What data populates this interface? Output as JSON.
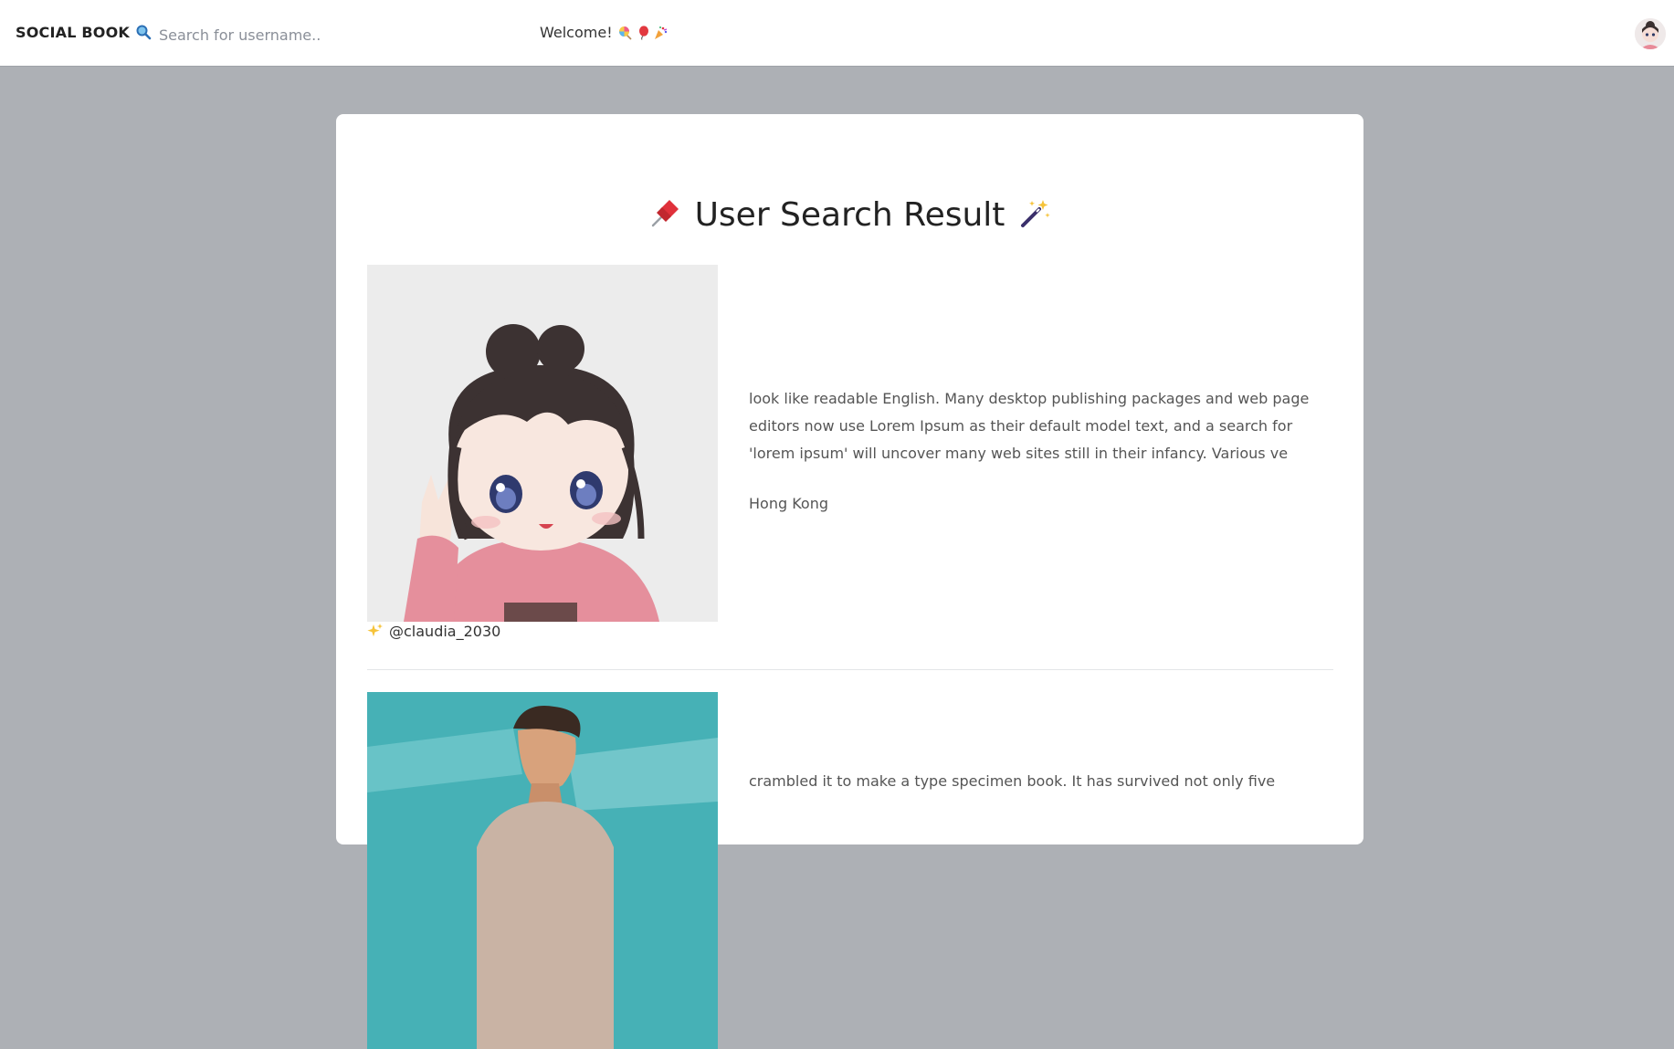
{
  "header": {
    "brand": "SOCIAL BOOK",
    "search": {
      "placeholder": "Search for username..",
      "value": ""
    },
    "welcome": "Welcome!",
    "welcome_icons": [
      "lollipop-icon",
      "balloon-icon",
      "party-popper-icon"
    ],
    "avatar_icon": "user-avatar-icon"
  },
  "page": {
    "title": "User Search Result",
    "title_icons": [
      "pushpin-icon",
      "magic-wand-icon"
    ]
  },
  "results": [
    {
      "handle": "@claudia_2030",
      "bio": "look like readable English. Many desktop publishing packages and web page editors now use Lorem Ipsum as their default model text, and a search for 'lorem ipsum' will uncover many web sites still in their infancy. Various ve",
      "location": "Hong Kong",
      "photo_icon": "anime-girl-avatar"
    },
    {
      "handle": "",
      "bio": "crambled it to make a type specimen book. It has survived not only five",
      "location": "",
      "photo_icon": "man-portrait"
    }
  ],
  "colors": {
    "page_background": "#adb0b5",
    "topbar": "#ffffff",
    "card": "#ffffff",
    "text": "#333333",
    "muted_text": "#555555",
    "accent_teal": "#46b1b6"
  }
}
